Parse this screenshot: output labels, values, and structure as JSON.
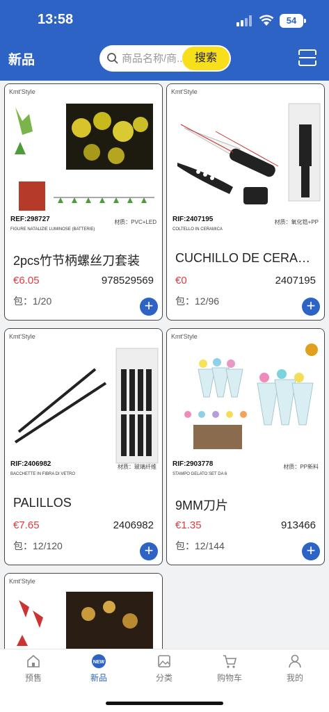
{
  "status": {
    "time": "13:58",
    "battery": "54"
  },
  "header": {
    "title": "新品",
    "search_placeholder": "商品名称/商...",
    "search_button": "搜索"
  },
  "products": [
    {
      "brand": "Kmt'Style",
      "sku": "REF:298727",
      "material": "材质：PVC+LED",
      "caption": "FIGURE NATALIZIE LUMINOSE (BATTERIE)",
      "name": "2pcs竹节柄螺丝刀套装",
      "price": "€6.05",
      "code": "978529569",
      "pack": "包：1/20"
    },
    {
      "brand": "Kmt'Style",
      "sku": "RIF:2407195",
      "material": "材质：氧化锆+PP",
      "caption": "COLTELLO IN CERAMICA",
      "name": "CUCHILLO DE CERAMICA",
      "price": "€0",
      "code": "2407195",
      "pack": "包：12/96"
    },
    {
      "brand": "Kmt'Style",
      "sku": "RIF:2406982",
      "material": "材质：玻璃纤维",
      "caption": "BACCHETTE IN FIBRA DI VETRO",
      "name": "PALILLOS",
      "price": "€7.65",
      "code": "2406982",
      "pack": "包：12/120"
    },
    {
      "brand": "Kmt'Style",
      "sku": "RIF:2903778",
      "material": "材质：PP新料",
      "caption": "STAMPO GELATO SET DA 6",
      "name": "9MM刀片",
      "price": "€1.35",
      "code": "913466",
      "pack": "包：12/144"
    },
    {
      "brand": "Kmt'Style",
      "sku": "",
      "material": "",
      "caption": "",
      "name": "",
      "price": "",
      "code": "",
      "pack": ""
    }
  ],
  "tabs": [
    {
      "label": "预售",
      "icon": "home-icon"
    },
    {
      "label": "新品",
      "icon": "new-badge-icon"
    },
    {
      "label": "分类",
      "icon": "image-icon"
    },
    {
      "label": "购物车",
      "icon": "cart-icon"
    },
    {
      "label": "我的",
      "icon": "user-icon"
    }
  ],
  "colors": {
    "brand_blue": "#2e63c6",
    "search_yellow": "#f7df1b",
    "price_red": "#e4393c"
  }
}
